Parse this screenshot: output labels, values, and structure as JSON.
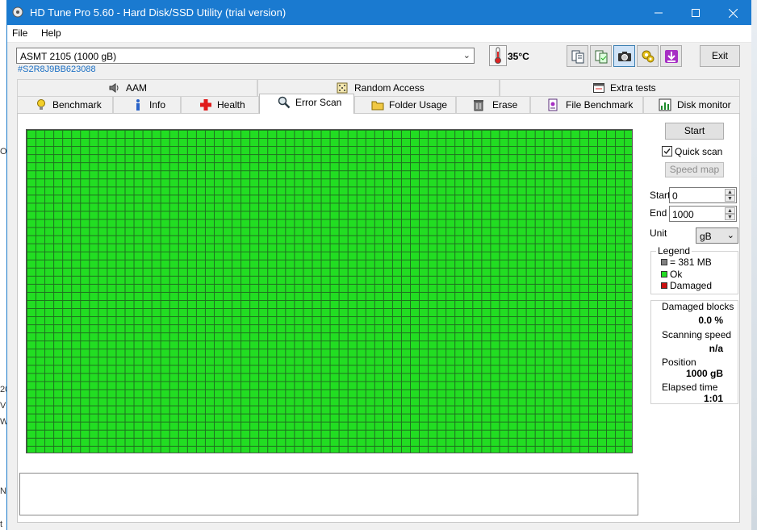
{
  "window": {
    "title": "HD Tune Pro 5.60 - Hard Disk/SSD Utility (trial version)"
  },
  "menu": {
    "file": "File",
    "help": "Help"
  },
  "drive": {
    "name": "ASMT   2105 (1000 gB)",
    "serial": "#S2R8J9BB623088"
  },
  "temperature": "35°C",
  "toolbar": {
    "exit": "Exit"
  },
  "tabs_top": [
    {
      "label": "AAM",
      "icon": "speaker-icon"
    },
    {
      "label": "Random Access",
      "icon": "dice-icon"
    },
    {
      "label": "Extra tests",
      "icon": "window-icon"
    }
  ],
  "tabs_bottom": [
    {
      "label": "Benchmark",
      "icon": "lightbulb-icon"
    },
    {
      "label": "Info",
      "icon": "info-icon"
    },
    {
      "label": "Health",
      "icon": "red-cross-icon"
    },
    {
      "label": "Error Scan",
      "icon": "magnifier-icon",
      "selected": true
    },
    {
      "label": "Folder Usage",
      "icon": "folder-icon"
    },
    {
      "label": "Erase",
      "icon": "trash-icon"
    },
    {
      "label": "File Benchmark",
      "icon": "file-icon"
    },
    {
      "label": "Disk monitor",
      "icon": "chart-icon"
    }
  ],
  "scan": {
    "start_button": "Start",
    "quick_scan_label": "Quick scan",
    "quick_scan_checked": true,
    "speed_map_button": "Speed map",
    "start_label": "Start",
    "start_value": "0",
    "end_label": "End",
    "end_value": "1000",
    "unit_label": "Unit",
    "unit_value": "gB"
  },
  "legend": {
    "title": "Legend",
    "block_size": "= 381 MB",
    "ok": "Ok",
    "damaged": "Damaged",
    "colors": {
      "block": "#808080",
      "ok": "#22dd22",
      "damaged": "#cc1111"
    }
  },
  "stats": {
    "damaged_blocks_label": "Damaged blocks",
    "damaged_blocks_value": "0.0 %",
    "scanning_speed_label": "Scanning speed",
    "scanning_speed_value": "n/a",
    "position_label": "Position",
    "position_value": "1000 gB",
    "elapsed_label": "Elapsed time",
    "elapsed_value": "1:01"
  },
  "edge_fragments": [
    "O",
    "20",
    "V",
    "W",
    "N",
    "t"
  ]
}
